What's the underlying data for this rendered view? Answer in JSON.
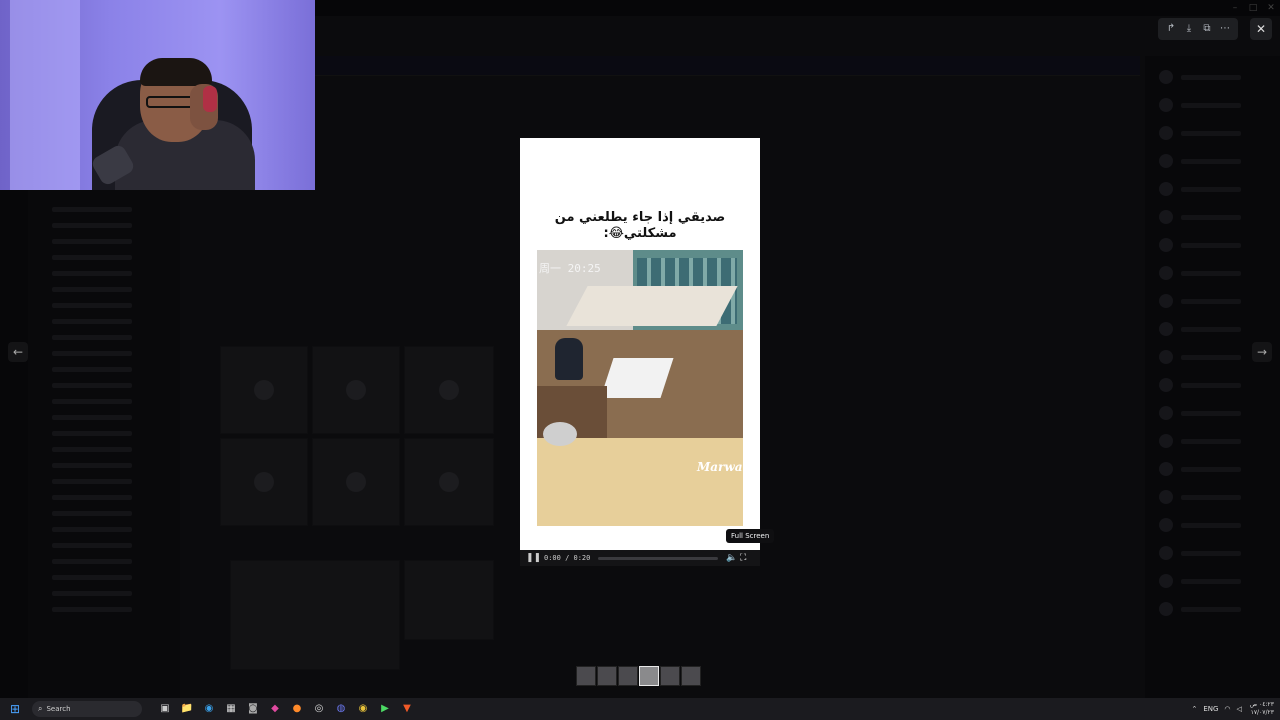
{
  "window": {
    "title": "",
    "minimize": "–",
    "maximize": "□",
    "close": "✕"
  },
  "viewer": {
    "tools": [
      {
        "name": "share-icon",
        "glyph": "↱"
      },
      {
        "name": "download-icon",
        "glyph": "⤓"
      },
      {
        "name": "open-external-icon",
        "glyph": "⧉"
      },
      {
        "name": "more-icon",
        "glyph": "⋯"
      }
    ],
    "close": "✕",
    "prev_arrow": "←",
    "next_arrow": "→"
  },
  "media": {
    "caption_line1": "صديقي إذا جاء يطلعني من",
    "caption_line2": "مشكلتي😂:",
    "video_timestamp": "周一 20:25",
    "watermark": "Marwa",
    "controls": {
      "pause": "❚❚",
      "time": "0:00 / 0:20",
      "volume": "🔈",
      "fullscreen": "⛶"
    },
    "tooltip": "Full Screen",
    "progress": 0
  },
  "thumbnails": {
    "count": 6,
    "active_index": 3
  },
  "taskbar": {
    "start": "⊞",
    "search_placeholder": "Search",
    "search_icon": "⌕",
    "apps": [
      {
        "name": "task-view-icon",
        "glyph": "▣"
      },
      {
        "name": "file-explorer-icon",
        "glyph": "📁"
      },
      {
        "name": "edge-icon",
        "glyph": "◉"
      },
      {
        "name": "store-icon",
        "glyph": "▦"
      },
      {
        "name": "camera-icon",
        "glyph": "◙"
      },
      {
        "name": "app-icon",
        "glyph": "◆"
      },
      {
        "name": "firefox-icon",
        "glyph": "●"
      },
      {
        "name": "obs-icon",
        "glyph": "◎"
      },
      {
        "name": "discord-icon",
        "glyph": "◍"
      },
      {
        "name": "chrome-icon",
        "glyph": "◉"
      },
      {
        "name": "media-player-icon",
        "glyph": "▶"
      },
      {
        "name": "brave-icon",
        "glyph": "▼"
      }
    ],
    "tray": {
      "chevron": "⌃",
      "lang": "ENG",
      "wifi": "◠",
      "volume": "◁",
      "clock_time": "٠٤:٢٣ ص",
      "clock_date": "١٧/٠٧/٢٣"
    }
  }
}
